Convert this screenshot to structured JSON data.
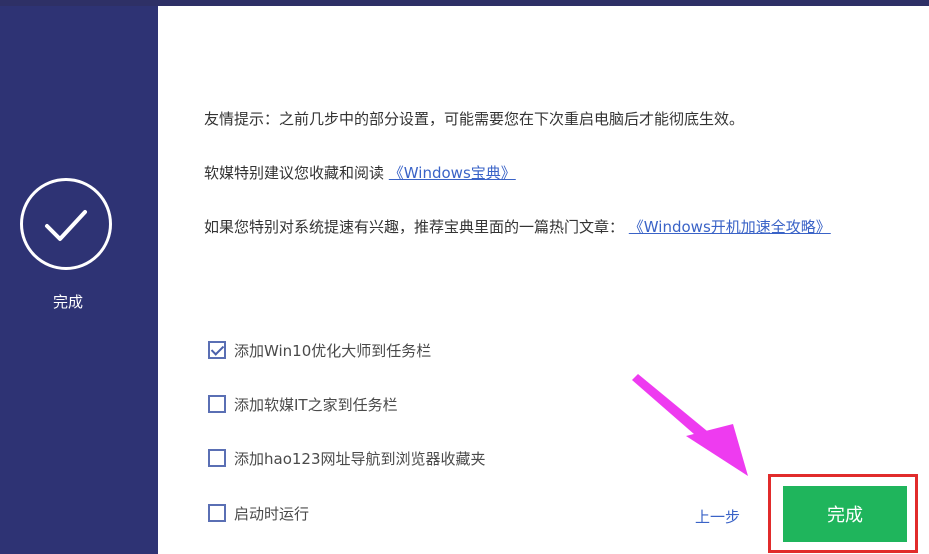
{
  "sidebar": {
    "step_label": "完成"
  },
  "tips": {
    "line1": "友情提示：之前几步中的部分设置，可能需要您在下次重启电脑后才能彻底生效。",
    "line2_prefix": "软媒特别建议您收藏和阅读",
    "line2_link": "《Windows宝典》",
    "line3_prefix": "如果您特别对系统提速有兴趣，推荐宝典里面的一篇热门文章：",
    "line3_link": "《Windows开机加速全攻略》"
  },
  "options": [
    {
      "label": "添加Win10优化大师到任务栏",
      "checked": true
    },
    {
      "label": "添加软媒IT之家到任务栏",
      "checked": false
    },
    {
      "label": "添加hao123网址导航到浏览器收藏夹",
      "checked": false
    },
    {
      "label": "启动时运行",
      "checked": false
    }
  ],
  "footer": {
    "prev_label": "上一步",
    "finish_label": "完成"
  },
  "colors": {
    "sidebar": "#2e3374",
    "finish_button": "#1fb55c",
    "highlight_box": "#e12b2b",
    "annotation_arrow": "#ee3bf0",
    "link": "#3a63c7"
  }
}
